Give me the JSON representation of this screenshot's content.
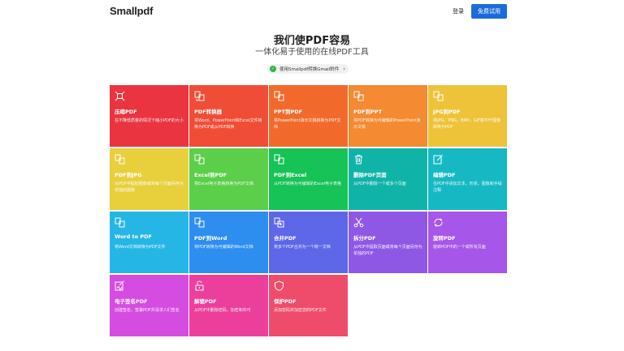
{
  "header": {
    "logo": "Smallpdf",
    "login_label": "登录",
    "trial_label": "免费试用"
  },
  "hero": {
    "title": "我们使PDF容易",
    "subtitle": "一体化易于使用的在线PDF工具"
  },
  "promo": {
    "label": "使用Smallpdf转换Gmail附件",
    "icon": "gmail-convert-icon"
  },
  "tools": [
    {
      "title": "压缩PDF",
      "desc": "在不降低质量的情况下缩小PDF的大小",
      "color": "#ea3440",
      "icon": "compress-icon"
    },
    {
      "title": "PDF转换器",
      "desc": "将Word、PowerPoint和Excel文件转换为PDF或从PDF转换",
      "color": "#f04d36",
      "icon": "converter-icon"
    },
    {
      "title": "PPT到PDF",
      "desc": "将PowerPoint演示文稿转换为PDF文档",
      "color": "#f26a2b",
      "icon": "ppt-to-pdf-icon"
    },
    {
      "title": "PDF到PPT",
      "desc": "将PDF转换为可编辑的PowerPoint演示文稿",
      "color": "#f48a31",
      "icon": "pdf-to-ppt-icon"
    },
    {
      "title": "JPG到PDF",
      "desc": "将JPG，PNG，BMP，GIF和TIFF图像转换为PDF",
      "color": "#eec33a",
      "icon": "jpg-to-pdf-icon"
    },
    {
      "title": "PDF到JPG",
      "desc": "从PDF中提取图像或将每个页面另存为单独的图像",
      "color": "#e8cf3c",
      "icon": "pdf-to-jpg-icon"
    },
    {
      "title": "Excel到PDF",
      "desc": "将Excel电子表格转换为PDF文档",
      "color": "#5bce4a",
      "icon": "excel-to-pdf-icon"
    },
    {
      "title": "PDF到Excel",
      "desc": "从PDF转换为可编辑的Excel电子表格",
      "color": "#17c257",
      "icon": "pdf-to-excel-icon"
    },
    {
      "title": "删除PDF页面",
      "desc": "从PDF中删除一个或多个页面",
      "color": "#10b3a8",
      "icon": "delete-pages-icon"
    },
    {
      "title": "编辑PDF",
      "desc": "在PDF中添加文本，形状，图像和手绘注释",
      "color": "#16b9c3",
      "icon": "edit-pdf-icon"
    },
    {
      "title": "Word to PDF",
      "desc": "将Word文档转换为PDF文件",
      "color": "#25b6e6",
      "icon": "word-to-pdf-icon"
    },
    {
      "title": "PDF到Word",
      "desc": "将PDF转换为可编辑的Word文档",
      "color": "#2d8ef0",
      "icon": "pdf-to-word-icon"
    },
    {
      "title": "合并PDF",
      "desc": "将多个PDF合并为一个统一文档",
      "color": "#5d67e8",
      "icon": "merge-pdf-icon"
    },
    {
      "title": "拆分PDF",
      "desc": "从PDF中提取页面或将每个页面另存为单独的PDF",
      "color": "#8f58e4",
      "icon": "split-pdf-icon"
    },
    {
      "title": "旋转PDF",
      "desc": "旋转PDF中的一个或所有页面",
      "color": "#a656e8",
      "icon": "rotate-pdf-icon"
    },
    {
      "title": "电子签名PDF",
      "desc": "创建签名，签署PDF并请求人们签名",
      "color": "#d54ce0",
      "icon": "esign-pdf-icon"
    },
    {
      "title": "解锁PDF",
      "desc": "从PDF中删除密码，加密和许可",
      "color": "#ec3f9b",
      "icon": "unlock-pdf-icon"
    },
    {
      "title": "保护PDF",
      "desc": "添加密码并加密您的PDF文件",
      "color": "#ef4c6b",
      "icon": "protect-pdf-icon"
    }
  ]
}
